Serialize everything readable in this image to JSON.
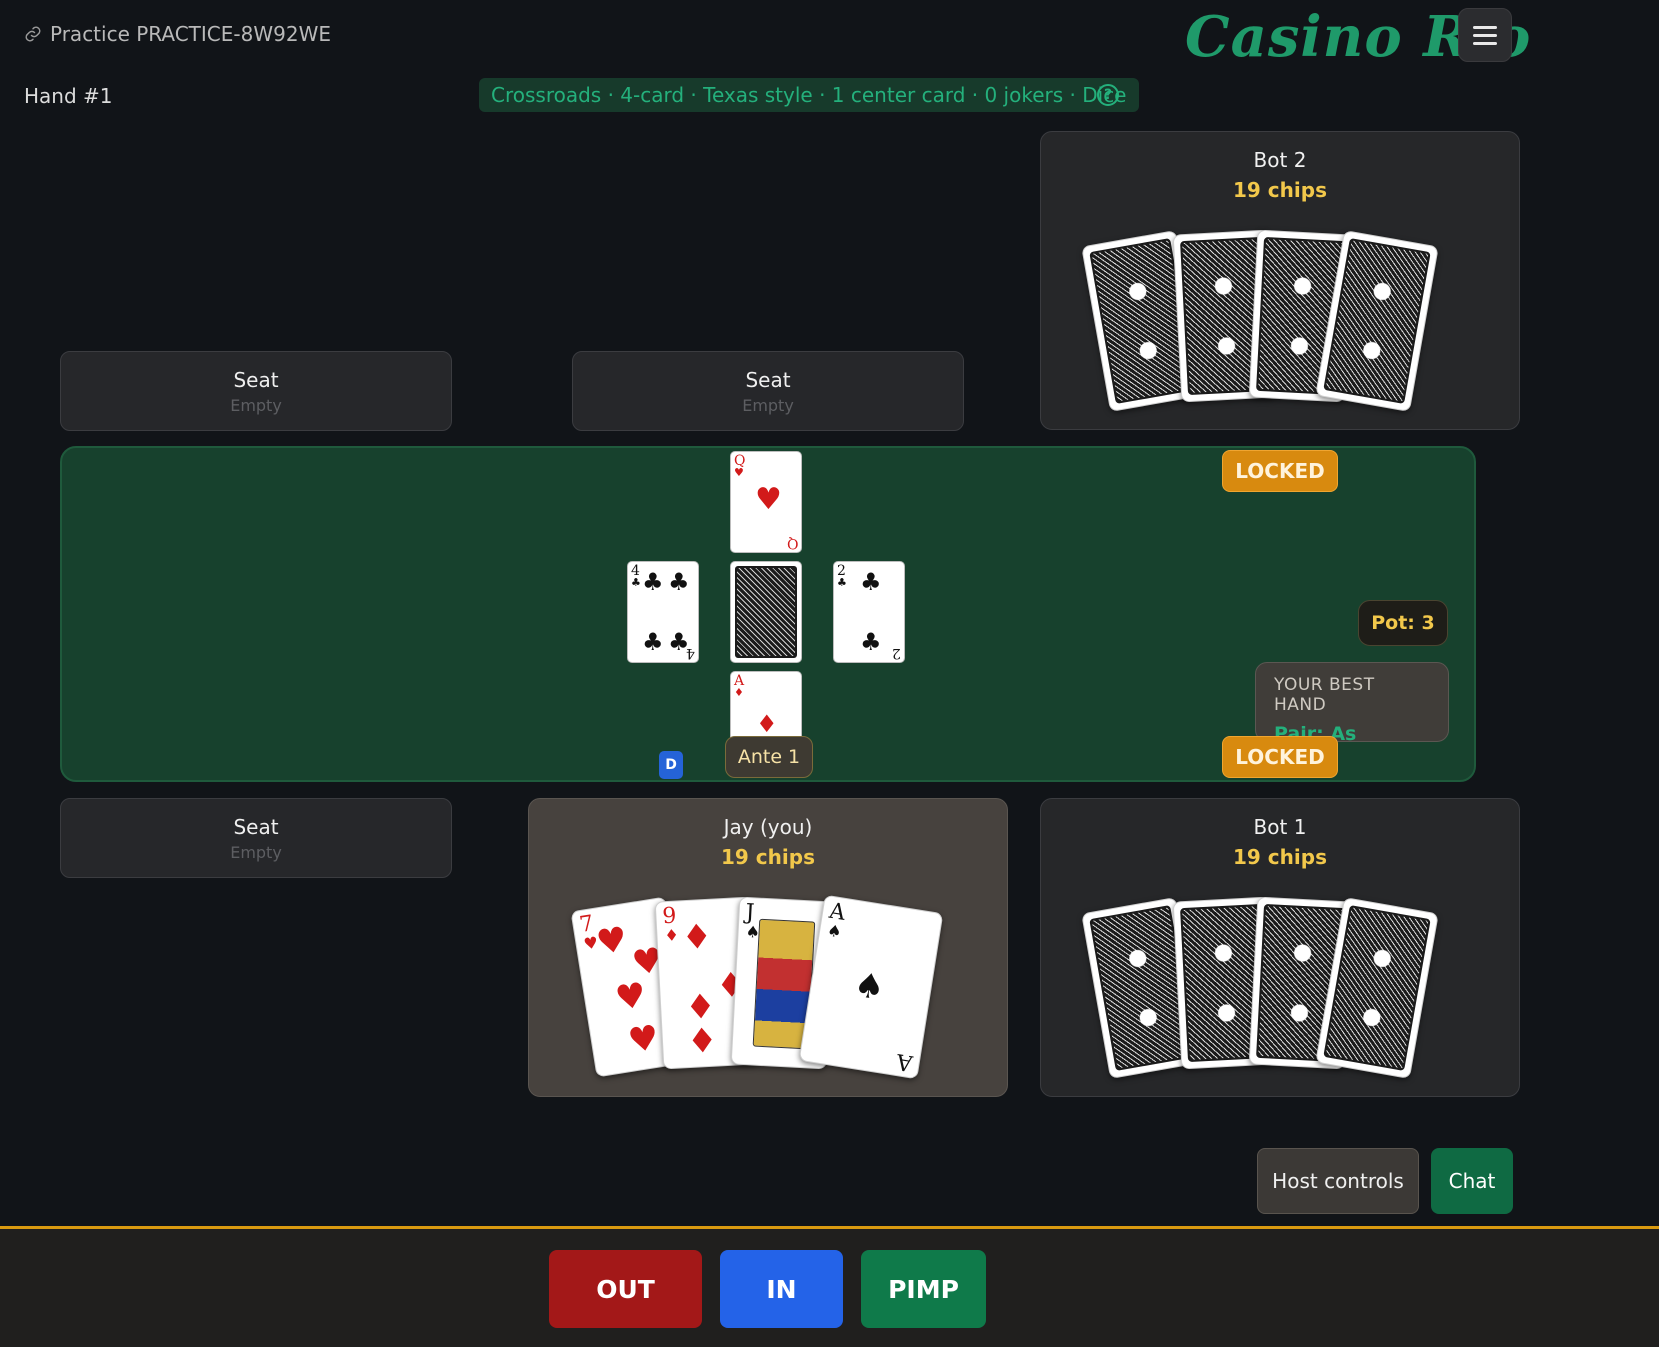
{
  "header": {
    "practice_label": "Practice PRACTICE-8W92WE",
    "brand": "Casino Rio",
    "hand_label": "Hand #1",
    "variant": "Crossroads · 4-card · Texas style · 1 center card · 0 jokers · Dice",
    "help_glyph": "?"
  },
  "seats": {
    "top_left": {
      "name": "Seat",
      "status": "Empty"
    },
    "top_mid": {
      "name": "Seat",
      "status": "Empty"
    },
    "bottom_left": {
      "name": "Seat",
      "status": "Empty"
    }
  },
  "players": {
    "bot2": {
      "name": "Bot 2",
      "chips": "19 chips",
      "cards": "face-down x4"
    },
    "you": {
      "name": "Jay (you)",
      "chips": "19 chips",
      "cards": [
        {
          "rank": "7",
          "suit": "♥",
          "color": "red"
        },
        {
          "rank": "9",
          "suit": "♦",
          "color": "red"
        },
        {
          "rank": "J",
          "suit": "♠",
          "color": "black"
        },
        {
          "rank": "A",
          "suit": "♠",
          "color": "black"
        }
      ]
    },
    "bot1": {
      "name": "Bot 1",
      "chips": "19 chips",
      "cards": "face-down x4"
    }
  },
  "table": {
    "locked_top": "LOCKED",
    "locked_bottom": "LOCKED",
    "pot": "Pot: 3",
    "best_hand_title": "YOUR BEST HAND",
    "best_hand_value": "Pair: As",
    "dealer_button": "D",
    "ante": "Ante 1",
    "crossroads": {
      "top": {
        "rank": "Q",
        "suit": "♥",
        "color": "red"
      },
      "left": {
        "rank": "4",
        "suit": "♣",
        "color": "black"
      },
      "center": {
        "face_down": true
      },
      "right": {
        "rank": "2",
        "suit": "♣",
        "color": "black"
      },
      "bottom": {
        "rank": "A",
        "suit": "♦",
        "color": "red"
      }
    }
  },
  "controls": {
    "host": "Host controls",
    "chat": "Chat"
  },
  "actions": {
    "out": "OUT",
    "in": "IN",
    "pimp": "PIMP"
  },
  "colors": {
    "brand": "#1f9a6a",
    "felt": "#17412d",
    "locked": "#d88a0f",
    "chips": "#f2c84b",
    "out": "#a31818",
    "in": "#2463e8",
    "pimp": "#0f7a4a",
    "accent_line": "#d99a10"
  }
}
